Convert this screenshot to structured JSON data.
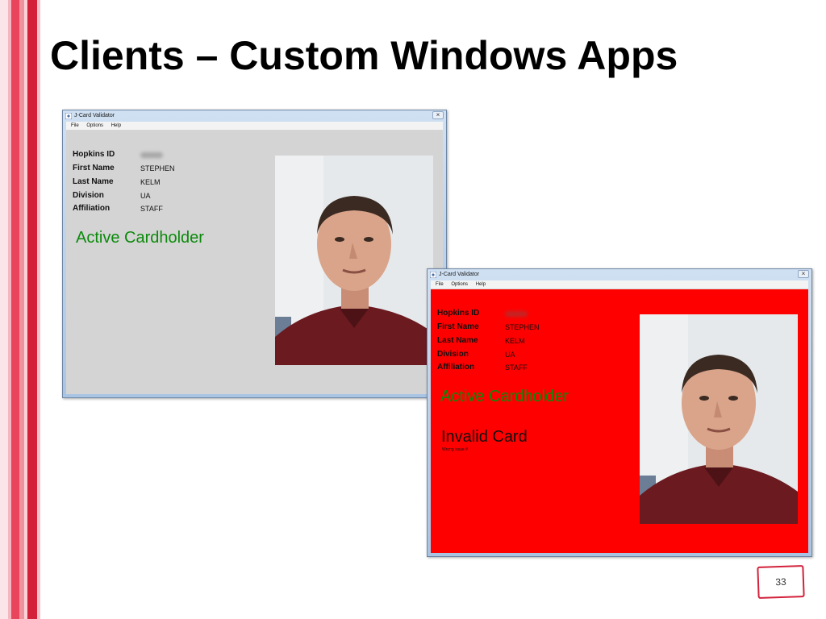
{
  "slide": {
    "title": "Clients – Custom Windows Apps",
    "page_number": "33"
  },
  "colors": {
    "accent_red": "#d3213a",
    "active_green": "#0b8a0b",
    "window_gray_bg": "#d4d4d4",
    "window_red_bg": "#ff0000"
  },
  "window_active": {
    "title": "J-Card Validator",
    "menu": [
      "File",
      "Options",
      "Help"
    ],
    "fields": [
      {
        "label": "Hopkins ID",
        "value": ""
      },
      {
        "label": "First Name",
        "value": "STEPHEN"
      },
      {
        "label": "Last Name",
        "value": "KELM"
      },
      {
        "label": "Division",
        "value": "UA"
      },
      {
        "label": "Affiliation",
        "value": "STAFF"
      }
    ],
    "status": "Active Cardholder"
  },
  "window_invalid": {
    "title": "J-Card Validator",
    "menu": [
      "File",
      "Options",
      "Help"
    ],
    "fields": [
      {
        "label": "Hopkins ID",
        "value": ""
      },
      {
        "label": "First Name",
        "value": "STEPHEN"
      },
      {
        "label": "Last Name",
        "value": "KELM"
      },
      {
        "label": "Division",
        "value": "UA"
      },
      {
        "label": "Affiliation",
        "value": "STAFF"
      }
    ],
    "status": "Active Cardholder",
    "invalid_title": "Invalid Card",
    "invalid_detail": "Wrong issue #"
  },
  "icons": {
    "app_icon": "app-icon",
    "close_icon": "close-icon"
  }
}
